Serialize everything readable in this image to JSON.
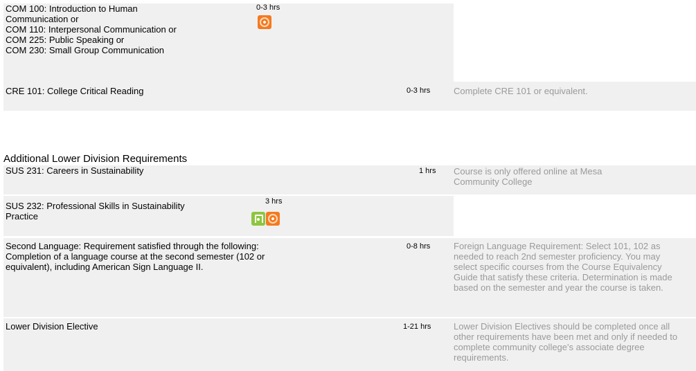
{
  "rows": [
    {
      "course": [
        "COM 100: Introduction to Human",
        "Communication or",
        "COM 110: Interpersonal Communication or",
        "COM 225: Public Speaking or",
        "COM 230: Small Group Communication"
      ],
      "hours": "0-3 hrs",
      "note": "",
      "icons": [
        "orange-target-icon"
      ]
    },
    {
      "course": [
        "CRE 101: College Critical Reading"
      ],
      "hours": "0-3 hrs",
      "note": "Complete CRE 101 or equivalent.",
      "icons": []
    }
  ],
  "section_title": "Additional Lower Division Requirements",
  "rows2": [
    {
      "course": [
        "SUS 231: Careers in Sustainability"
      ],
      "hours": "1 hrs",
      "note": "Course is only offered online at Mesa Community College",
      "icons": []
    },
    {
      "course": [
        "SUS 232: Professional Skills in Sustainability",
        "Practice"
      ],
      "hours": "3 hrs",
      "note": "",
      "icons": [
        "green-book-icon",
        "orange-target-icon"
      ]
    },
    {
      "course": [
        "Second Language: Requirement satisfied through the following:",
        "Completion of a language course at the second semester (102 or",
        "equivalent), including American Sign Language II."
      ],
      "hours": "0-8 hrs",
      "note": "Foreign Language Requirement: Select 101, 102 as needed to reach 2nd semester proficiency. You may select specific courses from the Course Equivalency Guide that satisfy these criteria. Determination is made based on the semester and year the course is taken.",
      "icons": []
    },
    {
      "course": [
        "Lower Division Elective"
      ],
      "hours": "1-21 hrs",
      "note": "Lower Division Electives should be completed once all other requirements have been met and only if needed to complete community college's associate degree requirements.",
      "icons": []
    }
  ]
}
